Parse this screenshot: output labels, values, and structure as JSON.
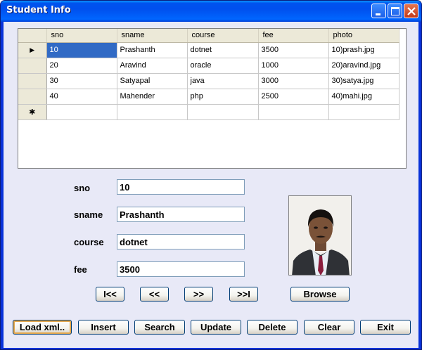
{
  "window": {
    "title": "Student Info"
  },
  "grid": {
    "columns": [
      "sno",
      "sname",
      "course",
      "fee",
      "photo"
    ],
    "rows": [
      {
        "sno": "10",
        "sname": "Prashanth",
        "course": "dotnet",
        "fee": "3500",
        "photo": "10)prash.jpg"
      },
      {
        "sno": "20",
        "sname": "Aravind",
        "course": "oracle",
        "fee": "1000",
        "photo": "20)aravind.jpg"
      },
      {
        "sno": "30",
        "sname": "Satyapal",
        "course": "java",
        "fee": "3000",
        "photo": "30)satya.jpg"
      },
      {
        "sno": "40",
        "sname": "Mahender",
        "course": "php",
        "fee": "2500",
        "photo": "40)mahi.jpg"
      }
    ],
    "current_row_marker": "▶",
    "new_row_marker": "✱"
  },
  "form": {
    "sno_label": "sno",
    "sname_label": "sname",
    "course_label": "course",
    "fee_label": "fee",
    "sno_value": "10",
    "sname_value": "Prashanth",
    "course_value": "dotnet",
    "fee_value": "3500"
  },
  "nav": {
    "first": "I<<",
    "prev": "<<",
    "next": ">>",
    "last": ">>I",
    "browse": "Browse"
  },
  "actions": {
    "load_xml": "Load xml..",
    "insert": "Insert",
    "search": "Search",
    "update": "Update",
    "delete": "Delete",
    "clear": "Clear",
    "exit": "Exit"
  }
}
